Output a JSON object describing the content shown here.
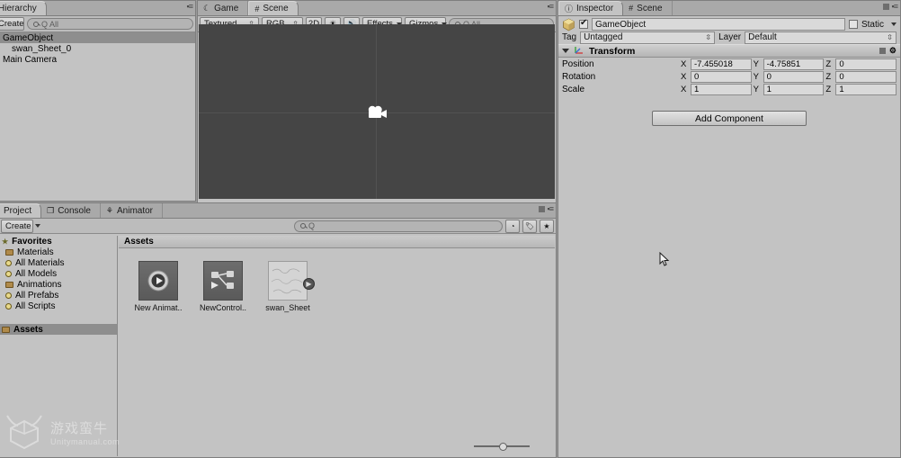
{
  "hierarchy": {
    "tab_label": "Hierarchy",
    "create_label": "Create",
    "search_placeholder": "Q All",
    "items": [
      {
        "label": "GameObject",
        "selected": true,
        "child": false
      },
      {
        "label": "swan_Sheet_0",
        "selected": false,
        "child": true
      },
      {
        "label": "Main Camera",
        "selected": false,
        "child": false
      }
    ]
  },
  "sceneview": {
    "tabs": [
      {
        "label": "Game",
        "icon": "game-controller-icon",
        "active": false
      },
      {
        "label": "Scene",
        "icon": "scene-grid-icon",
        "active": true
      }
    ],
    "toolbar": {
      "draw_mode": "Textured",
      "render_mode": "RGB",
      "mode_2d": "2D",
      "lighting_icon": "sun-icon",
      "audio_icon": "speaker-icon",
      "effects": "Effects",
      "gizmos": "Gizmos",
      "search_placeholder": "Q All"
    },
    "gizmo": "camera-gizmo"
  },
  "inspector": {
    "tabs": [
      {
        "label": "Inspector",
        "icon": "inspector-info-icon",
        "active": true
      },
      {
        "label": "Scene",
        "icon": "scene-grid-icon",
        "active": false
      }
    ],
    "object_name": "GameObject",
    "enabled": true,
    "static_label": "Static",
    "static_checked": false,
    "tag_label": "Tag",
    "tag_value": "Untagged",
    "layer_label": "Layer",
    "layer_value": "Default",
    "transform": {
      "title": "Transform",
      "rows": [
        {
          "label": "Position",
          "x": "-7.455018",
          "y": "-4.75851",
          "z": "0"
        },
        {
          "label": "Rotation",
          "x": "0",
          "y": "0",
          "z": "0"
        },
        {
          "label": "Scale",
          "x": "1",
          "y": "1",
          "z": "1"
        }
      ],
      "axes": [
        "X",
        "Y",
        "Z"
      ]
    },
    "add_component_label": "Add Component"
  },
  "project": {
    "tabs": [
      {
        "label": "Project",
        "icon": "project-icon",
        "active": true
      },
      {
        "label": "Console",
        "icon": "console-icon",
        "active": false
      },
      {
        "label": "Animator",
        "icon": "animator-icon",
        "active": false
      }
    ],
    "create_label": "Create",
    "search_placeholder": "Q",
    "tree": [
      {
        "label": "Favorites",
        "icon": "star-icon",
        "kind": "head",
        "selected": false
      },
      {
        "label": "Materials",
        "icon": "folder-icon",
        "kind": "item",
        "selected": false
      },
      {
        "label": "All Materials",
        "icon": "search-folder-icon",
        "kind": "item",
        "selected": false
      },
      {
        "label": "All Models",
        "icon": "search-folder-icon",
        "kind": "item",
        "selected": false
      },
      {
        "label": "Animations",
        "icon": "folder-icon",
        "kind": "item",
        "selected": false
      },
      {
        "label": "All Prefabs",
        "icon": "search-folder-icon",
        "kind": "item",
        "selected": false
      },
      {
        "label": "All Scripts",
        "icon": "search-folder-icon",
        "kind": "item",
        "selected": false
      },
      {
        "label": "",
        "icon": "",
        "kind": "spacer",
        "selected": false
      },
      {
        "label": "Assets",
        "icon": "folder-icon",
        "kind": "head",
        "selected": true
      }
    ],
    "breadcrumb": "Assets",
    "assets": [
      {
        "label": "New Animat..",
        "type": "animation-clip"
      },
      {
        "label": "NewControl..",
        "type": "animator-controller"
      },
      {
        "label": "swan_Sheet",
        "type": "sprite-sheet"
      }
    ],
    "zoom_value": 45
  },
  "watermark": {
    "cn": "游戏蛮牛",
    "en": "Unitymanual.com"
  },
  "colors": {
    "panel_bg": "#c3c3c3",
    "tabbar_bg": "#a9a9a9",
    "scene_bg": "#454545",
    "selection": "#8e8e8e",
    "border": "#7e7e7e"
  }
}
